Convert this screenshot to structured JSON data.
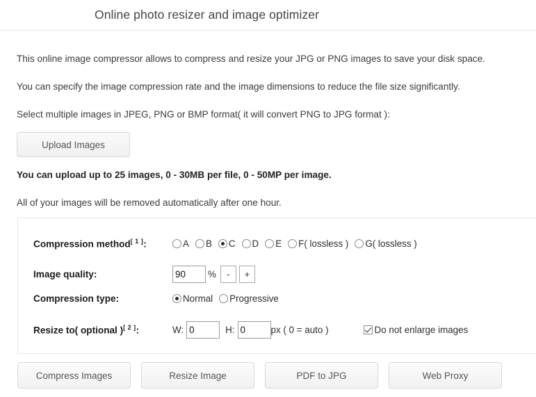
{
  "header": {
    "title": "Online photo resizer and image optimizer"
  },
  "intro": {
    "line1": "This online image compressor allows to compress and resize your JPG or PNG images to save your disk space.",
    "line2": "You can specify the image compression rate and the image dimensions to reduce the file size significantly.",
    "line3": "Select multiple images in JPEG, PNG or BMP format( it will convert PNG to JPG format ):",
    "upload_limits": "You can upload up to 25 images, 0 - 30MB per file, 0 - 50MP per image.",
    "retention_notice": "All of your images will be removed automatically after one hour."
  },
  "upload": {
    "button_label": "Upload Images"
  },
  "form": {
    "compression_method": {
      "label": "Compression method",
      "superscript": "[ 1 ]",
      "colon": ":",
      "selected": "C",
      "options": [
        {
          "value": "A",
          "label": "A",
          "checked": false
        },
        {
          "value": "B",
          "label": "B",
          "checked": false
        },
        {
          "value": "C",
          "label": "C",
          "checked": true
        },
        {
          "value": "D",
          "label": "D",
          "checked": false
        },
        {
          "value": "E",
          "label": "E",
          "checked": false
        },
        {
          "value": "F",
          "label": "F( lossless )",
          "checked": false
        },
        {
          "value": "G",
          "label": "G( lossless )",
          "checked": false
        }
      ]
    },
    "image_quality": {
      "label": "Image quality:",
      "value": "90",
      "unit": "%",
      "decrement_label": "-",
      "increment_label": "+"
    },
    "compression_type": {
      "label": "Compression type:",
      "selected": "Normal",
      "options": [
        {
          "value": "Normal",
          "label": "Normal",
          "checked": true
        },
        {
          "value": "Progressive",
          "label": "Progressive",
          "checked": false
        }
      ]
    },
    "resize_to": {
      "label": "Resize to( optional )",
      "superscript": "[ 2 ]",
      "colon": ":",
      "width_prefix": "W:",
      "width_value": "0",
      "height_prefix": "H:",
      "height_value": "0",
      "unit_note": "px ( 0 = auto )",
      "do_not_enlarge_label": "Do not enlarge images",
      "do_not_enlarge_checked": true
    }
  },
  "footer": {
    "buttons": [
      {
        "label": "Compress Images"
      },
      {
        "label": "Resize Image"
      },
      {
        "label": "PDF to JPG"
      },
      {
        "label": "Web Proxy"
      }
    ]
  },
  "colors": {
    "page_background": "#ffffff",
    "text": "#333333",
    "divider": "#e8e8e8",
    "panel_border": "#e6e6e6",
    "button_border": "#d8d8d8"
  }
}
